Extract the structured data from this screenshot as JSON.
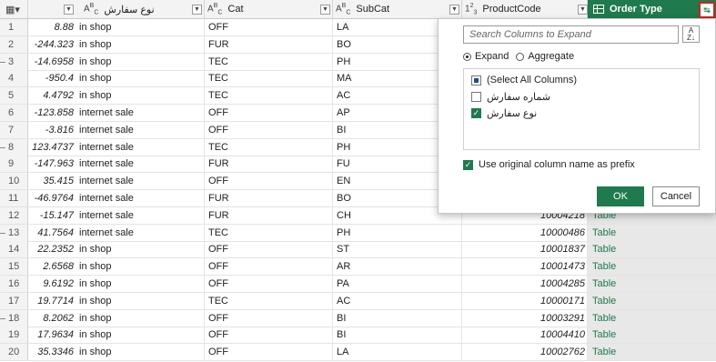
{
  "columns": {
    "amount": {
      "type_glyph": "A B C",
      "name": "نوع سفارش"
    },
    "cat": {
      "name": "Cat"
    },
    "subcat": {
      "name": "SubCat"
    },
    "productcode": {
      "type_glyph": "1 2 3",
      "name": "ProductCode"
    },
    "order_type": {
      "name": "Order Type"
    }
  },
  "rows": [
    {
      "idx": "1",
      "amount": "8.88",
      "order": "in shop",
      "cat": "OFF",
      "sub": "LA",
      "pc": "",
      "ot": ""
    },
    {
      "idx": "2",
      "amount": "-244.323",
      "order": "in shop",
      "cat": "FUR",
      "sub": "BO",
      "pc": "",
      "ot": ""
    },
    {
      "idx": "3",
      "amount": "-14.6958",
      "order": "in shop",
      "cat": "TEC",
      "sub": "PH",
      "pc": "",
      "ot": ""
    },
    {
      "idx": "4",
      "amount": "-950.4",
      "order": "in shop",
      "cat": "TEC",
      "sub": "MA",
      "pc": "",
      "ot": ""
    },
    {
      "idx": "5",
      "amount": "4.4792",
      "order": "in shop",
      "cat": "TEC",
      "sub": "AC",
      "pc": "",
      "ot": ""
    },
    {
      "idx": "6",
      "amount": "-123.858",
      "order": "internet sale",
      "cat": "OFF",
      "sub": "AP",
      "pc": "",
      "ot": ""
    },
    {
      "idx": "7",
      "amount": "-3.816",
      "order": "internet sale",
      "cat": "OFF",
      "sub": "BI",
      "pc": "",
      "ot": ""
    },
    {
      "idx": "8",
      "amount": "123.4737",
      "order": "internet sale",
      "cat": "TEC",
      "sub": "PH",
      "pc": "",
      "ot": ""
    },
    {
      "idx": "9",
      "amount": "-147.963",
      "order": "internet sale",
      "cat": "FUR",
      "sub": "FU",
      "pc": "",
      "ot": ""
    },
    {
      "idx": "10",
      "amount": "35.415",
      "order": "internet sale",
      "cat": "OFF",
      "sub": "EN",
      "pc": "",
      "ot": ""
    },
    {
      "idx": "11",
      "amount": "-46.9764",
      "order": "internet sale",
      "cat": "FUR",
      "sub": "BO",
      "pc": "",
      "ot": ""
    },
    {
      "idx": "12",
      "amount": "-15.147",
      "order": "internet sale",
      "cat": "FUR",
      "sub": "CH",
      "pc": "10004218",
      "ot": "Table"
    },
    {
      "idx": "13",
      "amount": "41.7564",
      "order": "internet sale",
      "cat": "TEC",
      "sub": "PH",
      "pc": "10000486",
      "ot": "Table"
    },
    {
      "idx": "14",
      "amount": "22.2352",
      "order": "in shop",
      "cat": "OFF",
      "sub": "ST",
      "pc": "10001837",
      "ot": "Table"
    },
    {
      "idx": "15",
      "amount": "2.6568",
      "order": "in shop",
      "cat": "OFF",
      "sub": "AR",
      "pc": "10001473",
      "ot": "Table"
    },
    {
      "idx": "16",
      "amount": "9.6192",
      "order": "in shop",
      "cat": "OFF",
      "sub": "PA",
      "pc": "10004285",
      "ot": "Table"
    },
    {
      "idx": "17",
      "amount": "19.7714",
      "order": "in shop",
      "cat": "TEC",
      "sub": "AC",
      "pc": "10000171",
      "ot": "Table"
    },
    {
      "idx": "18",
      "amount": "8.2062",
      "order": "in shop",
      "cat": "OFF",
      "sub": "BI",
      "pc": "10003291",
      "ot": "Table"
    },
    {
      "idx": "19",
      "amount": "17.9634",
      "order": "in shop",
      "cat": "OFF",
      "sub": "BI",
      "pc": "10004410",
      "ot": "Table"
    },
    {
      "idx": "20",
      "amount": "35.3346",
      "order": "in shop",
      "cat": "OFF",
      "sub": "LA",
      "pc": "10002762",
      "ot": "Table"
    }
  ],
  "expand_panel": {
    "search_placeholder": "Search Columns to Expand",
    "expand_label": "Expand",
    "aggregate_label": "Aggregate",
    "items": [
      {
        "label": "(Select All Columns)",
        "state": "partial"
      },
      {
        "label": "شماره سفارش",
        "state": "unchecked"
      },
      {
        "label": "نوع سفارش",
        "state": "checked"
      }
    ],
    "prefix_label": "Use original column name as prefix",
    "ok_label": "OK",
    "cancel_label": "Cancel"
  },
  "colors": {
    "accent": "#1f7a4d",
    "highlight": "#d02020"
  }
}
